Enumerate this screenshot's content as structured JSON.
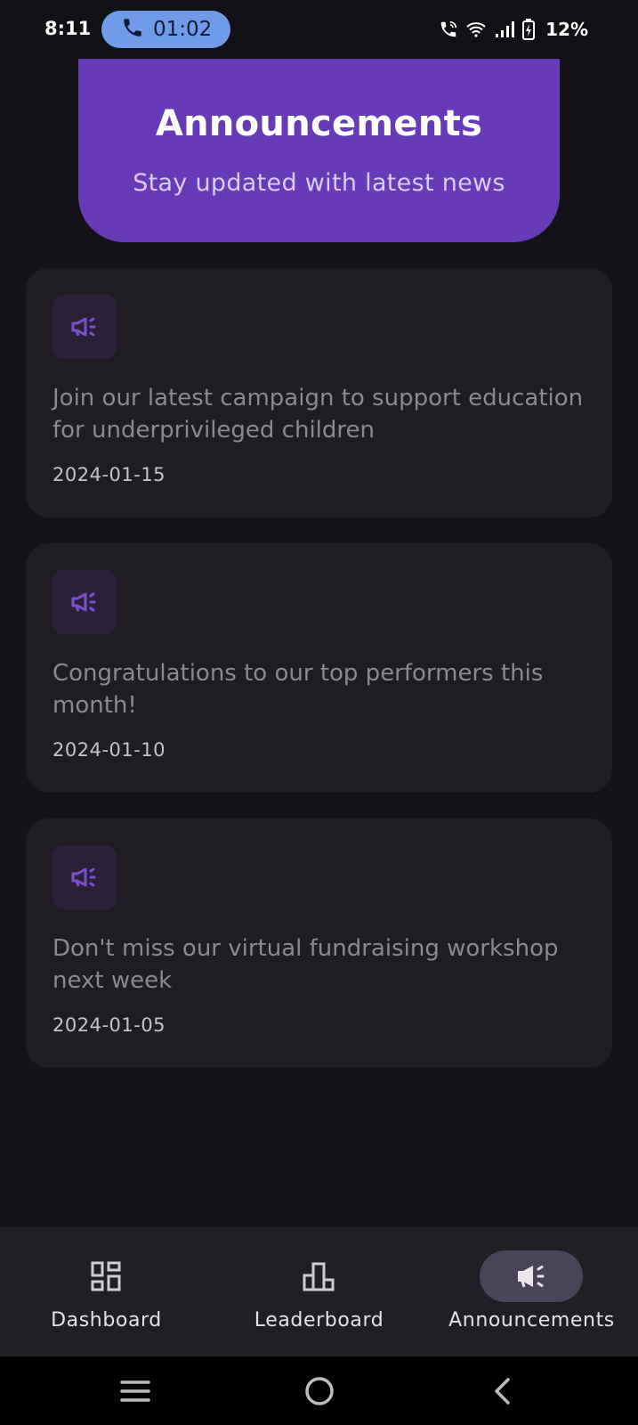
{
  "status_bar": {
    "time": "8:11",
    "call_timer": "01:02",
    "battery_percent": "12%",
    "icons": [
      "phone-icon",
      "wifi-calling-icon",
      "wifi-icon",
      "signal-icon",
      "battery-charging-icon"
    ]
  },
  "header": {
    "title": "Announcements",
    "subtitle": "Stay updated with latest news",
    "color": "#673ab7"
  },
  "announcements": [
    {
      "icon": "megaphone-icon",
      "text": "Join our latest campaign to support education for underprivileged children",
      "date": "2024-01-15"
    },
    {
      "icon": "megaphone-icon",
      "text": "Congratulations to our top performers this month!",
      "date": "2024-01-10"
    },
    {
      "icon": "megaphone-icon",
      "text": "Don't miss our virtual fundraising workshop next week",
      "date": "2024-01-05"
    }
  ],
  "bottom_nav": {
    "items": [
      {
        "label": "Dashboard",
        "icon": "dashboard-icon",
        "active": false
      },
      {
        "label": "Leaderboard",
        "icon": "leaderboard-icon",
        "active": false
      },
      {
        "label": "Announcements",
        "icon": "megaphone-icon",
        "active": true
      }
    ]
  },
  "system_nav": {
    "icons": [
      "recent-apps-icon",
      "home-icon",
      "back-icon"
    ]
  },
  "colors": {
    "accent": "#673ab7",
    "background": "#141218",
    "card": "#1f1d23",
    "active_pill": "#4a4458"
  }
}
